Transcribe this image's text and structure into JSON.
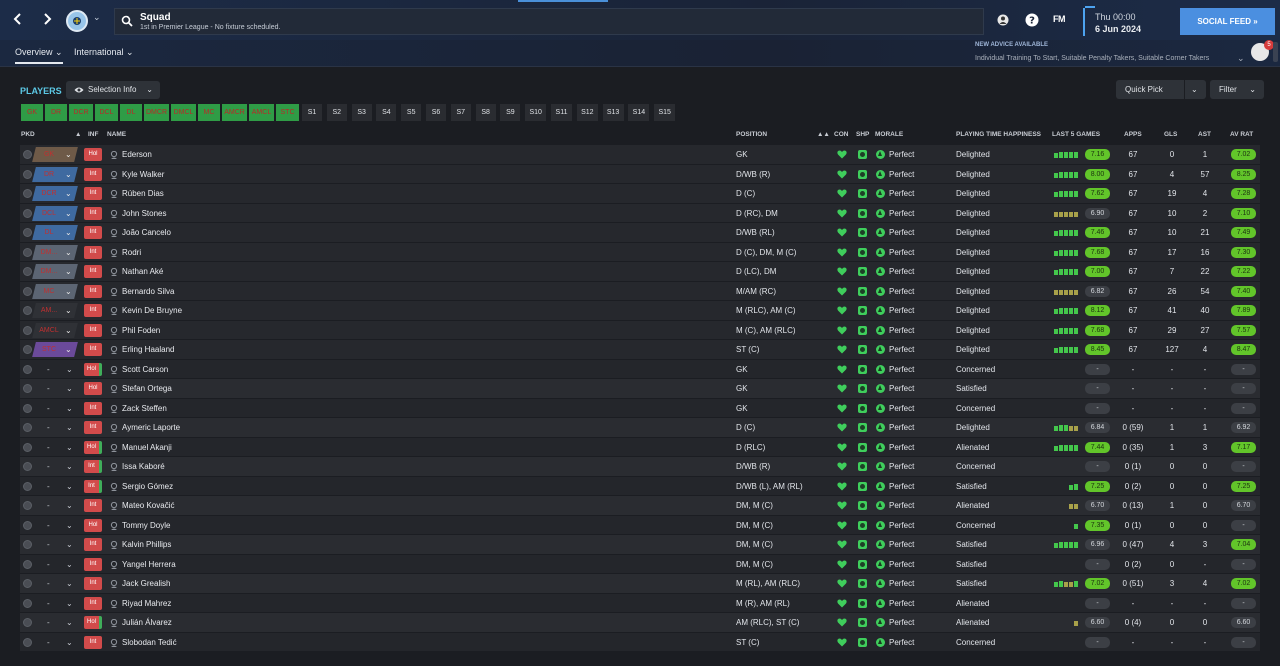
{
  "topbar": {
    "title": "Squad",
    "subtitle": "1st in Premier League - No fixture scheduled.",
    "fm_logo": "FM",
    "date_day": "Thu 00:00",
    "date_date": "6 Jun 2024",
    "social_feed": "SOCIAL FEED  »",
    "back_icon": "chevron-left-icon",
    "forward_icon": "chevron-right-icon"
  },
  "subbar": {
    "tabs": [
      {
        "label": "Overview ⌄"
      },
      {
        "label": "International ⌄"
      }
    ],
    "advice_title": "NEW ADVICE AVAILABLE",
    "advice_text": "Individual Training To Start, Suitable Penalty Takers, Suitable Corner Takers",
    "advice_count": "5"
  },
  "players": {
    "title": "PLAYERS",
    "selection_info": "Selection Info",
    "quick_pick": "Quick Pick",
    "filter": "Filter"
  },
  "position_buttons": [
    "GK",
    "DR",
    "DCR",
    "DCL",
    "DL",
    "DMCR",
    "DMCL",
    "MC",
    "AMCR",
    "AMCL",
    "STC",
    "S1",
    "S2",
    "S3",
    "S4",
    "S5",
    "S6",
    "S7",
    "S8",
    "S9",
    "S10",
    "S11",
    "S12",
    "S13",
    "S14",
    "S15"
  ],
  "columns": {
    "pkd": "PKD",
    "inf": "INF",
    "name": "NAME",
    "position": "POSITION",
    "con": "CON",
    "shp": "SHP",
    "morale": "MORALE",
    "pth": "PLAYING TIME HAPPINESS",
    "last5": "LAST 5 GAMES",
    "apps": "APPS",
    "gls": "GLS",
    "ast": "AST",
    "avrat": "AV RAT"
  },
  "rows": [
    {
      "pkd": "GK",
      "pkd_color": "#6e5a48",
      "inf": "Hol",
      "name": "Ederson",
      "position": "GK",
      "morale": "Perfect",
      "pth": "Delighted",
      "form": [
        3,
        4,
        4,
        4,
        4
      ],
      "last": "7.16",
      "apps": "67",
      "gls": "0",
      "ast": "1",
      "avrat": "7.02",
      "green_edge": false
    },
    {
      "pkd": "DR",
      "pkd_color": "#3f6aa0",
      "inf": "Int",
      "name": "Kyle Walker",
      "position": "D/WB (R)",
      "morale": "Perfect",
      "pth": "Delighted",
      "form": [
        3,
        4,
        4,
        4,
        4
      ],
      "last": "8.00",
      "apps": "67",
      "gls": "4",
      "ast": "57",
      "avrat": "8.25",
      "green_edge": false
    },
    {
      "pkd": "DCR",
      "pkd_color": "#3f6aa0",
      "inf": "Int",
      "name": "Rúben Dias",
      "position": "D (C)",
      "morale": "Perfect",
      "pth": "Delighted",
      "form": [
        3,
        4,
        4,
        4,
        4
      ],
      "last": "7.62",
      "apps": "67",
      "gls": "19",
      "ast": "4",
      "avrat": "7.28",
      "green_edge": false
    },
    {
      "pkd": "DCL",
      "pkd_color": "#3f6aa0",
      "inf": "Int",
      "name": "John Stones",
      "position": "D (RC), DM",
      "morale": "Perfect",
      "pth": "Delighted",
      "form": [
        1,
        1,
        1,
        1,
        1
      ],
      "last": "6.90",
      "apps": "67",
      "gls": "10",
      "ast": "2",
      "avrat": "7.10",
      "green_edge": false,
      "last_dark": true
    },
    {
      "pkd": "DL",
      "pkd_color": "#3f6aa0",
      "inf": "Int",
      "name": "João Cancelo",
      "position": "D/WB (RL)",
      "morale": "Perfect",
      "pth": "Delighted",
      "form": [
        3,
        4,
        4,
        4,
        4
      ],
      "last": "7.46",
      "apps": "67",
      "gls": "10",
      "ast": "21",
      "avrat": "7.49",
      "green_edge": false
    },
    {
      "pkd": "DM...",
      "pkd_color": "#5c6573",
      "inf": "Int",
      "name": "Rodri",
      "position": "D (C), DM, M (C)",
      "morale": "Perfect",
      "pth": "Delighted",
      "form": [
        3,
        4,
        4,
        4,
        4
      ],
      "last": "7.68",
      "apps": "67",
      "gls": "17",
      "ast": "16",
      "avrat": "7.30",
      "green_edge": false
    },
    {
      "pkd": "DM...",
      "pkd_color": "#5c6573",
      "inf": "Int",
      "name": "Nathan Aké",
      "position": "D (LC), DM",
      "morale": "Perfect",
      "pth": "Delighted",
      "form": [
        3,
        4,
        4,
        4,
        4
      ],
      "last": "7.00",
      "apps": "67",
      "gls": "7",
      "ast": "22",
      "avrat": "7.22",
      "green_edge": false
    },
    {
      "pkd": "MC",
      "pkd_color": "#5c6573",
      "inf": "Int",
      "name": "Bernardo Silva",
      "position": "M/AM (RC)",
      "morale": "Perfect",
      "pth": "Delighted",
      "form": [
        1,
        1,
        1,
        1,
        1
      ],
      "last": "6.82",
      "apps": "67",
      "gls": "26",
      "ast": "54",
      "avrat": "7.40",
      "green_edge": false,
      "last_dark": true
    },
    {
      "pkd": "AM...",
      "pkd_color": "#2f3136",
      "inf": "Int",
      "name": "Kevin De Bruyne",
      "position": "M (RLC), AM (C)",
      "morale": "Perfect",
      "pth": "Delighted",
      "form": [
        3,
        4,
        4,
        4,
        4
      ],
      "last": "8.12",
      "apps": "67",
      "gls": "41",
      "ast": "40",
      "avrat": "7.89",
      "green_edge": false
    },
    {
      "pkd": "AMCL",
      "pkd_color": "#2f3136",
      "inf": "Int",
      "name": "Phil Foden",
      "position": "M (C), AM (RLC)",
      "morale": "Perfect",
      "pth": "Delighted",
      "form": [
        3,
        4,
        4,
        4,
        4
      ],
      "last": "7.68",
      "apps": "67",
      "gls": "29",
      "ast": "27",
      "avrat": "7.57",
      "green_edge": false
    },
    {
      "pkd": "STC",
      "pkd_color": "#6b4a9a",
      "inf": "Int",
      "name": "Erling Haaland",
      "position": "ST (C)",
      "morale": "Perfect",
      "pth": "Delighted",
      "form": [
        3,
        4,
        4,
        4,
        4
      ],
      "last": "8.45",
      "apps": "67",
      "gls": "127",
      "ast": "4",
      "avrat": "8.47",
      "green_edge": false
    },
    {
      "pkd": "",
      "inf": "Hol",
      "name": "Scott Carson",
      "position": "GK",
      "morale": "Perfect",
      "pth": "Concerned",
      "form": [],
      "last": "-",
      "apps": "-",
      "gls": "-",
      "ast": "-",
      "avrat": "-",
      "green_edge": true
    },
    {
      "pkd": "",
      "inf": "Hol",
      "name": "Stefan Ortega",
      "position": "GK",
      "morale": "Perfect",
      "pth": "Satisfied",
      "form": [],
      "last": "-",
      "apps": "-",
      "gls": "-",
      "ast": "-",
      "avrat": "-",
      "green_edge": false
    },
    {
      "pkd": "",
      "inf": "Int",
      "name": "Zack Steffen",
      "position": "GK",
      "morale": "Perfect",
      "pth": "Concerned",
      "form": [],
      "last": "-",
      "apps": "-",
      "gls": "-",
      "ast": "-",
      "avrat": "-",
      "green_edge": false
    },
    {
      "pkd": "",
      "inf": "Int",
      "name": "Aymeric Laporte",
      "position": "D (C)",
      "morale": "Perfect",
      "pth": "Delighted",
      "form": [
        3,
        4,
        4,
        1,
        1
      ],
      "last": "6.84",
      "apps": "0 (59)",
      "gls": "1",
      "ast": "1",
      "avrat": "6.92",
      "green_edge": false,
      "last_dark": true,
      "av_dark": true
    },
    {
      "pkd": "",
      "inf": "Hol",
      "name": "Manuel Akanji",
      "position": "D (RLC)",
      "morale": "Perfect",
      "pth": "Alienated",
      "form": [
        3,
        4,
        4,
        4,
        4
      ],
      "last": "7.44",
      "apps": "0 (35)",
      "gls": "1",
      "ast": "3",
      "avrat": "7.17",
      "green_edge": true
    },
    {
      "pkd": "",
      "inf": "Int",
      "name": "Issa Kaboré",
      "position": "D/WB (R)",
      "morale": "Perfect",
      "pth": "Concerned",
      "form": [],
      "last": "-",
      "apps": "0 (1)",
      "gls": "0",
      "ast": "0",
      "avrat": "-",
      "green_edge": true
    },
    {
      "pkd": "",
      "inf": "Int",
      "name": "Sergio Gómez",
      "position": "D/WB (L), AM (RL)",
      "morale": "Perfect",
      "pth": "Satisfied",
      "form": [
        3,
        4
      ],
      "last": "7.25",
      "apps": "0 (2)",
      "gls": "0",
      "ast": "0",
      "avrat": "7.25",
      "green_edge": true
    },
    {
      "pkd": "",
      "inf": "Int",
      "name": "Mateo Kovačić",
      "position": "DM, M (C)",
      "morale": "Perfect",
      "pth": "Alienated",
      "form": [
        1,
        1
      ],
      "last": "6.70",
      "apps": "0 (13)",
      "gls": "1",
      "ast": "0",
      "avrat": "6.70",
      "green_edge": false,
      "last_dark": true,
      "av_dark": true
    },
    {
      "pkd": "",
      "inf": "Hol",
      "name": "Tommy Doyle",
      "position": "DM, M (C)",
      "morale": "Perfect",
      "pth": "Concerned",
      "form": [
        3
      ],
      "last": "7.35",
      "apps": "0 (1)",
      "gls": "0",
      "ast": "0",
      "avrat": "-",
      "green_edge": false
    },
    {
      "pkd": "",
      "inf": "Int",
      "name": "Kalvin Phillips",
      "position": "DM, M (C)",
      "morale": "Perfect",
      "pth": "Satisfied",
      "form": [
        3,
        4,
        4,
        4,
        4
      ],
      "last": "6.96",
      "apps": "0 (47)",
      "gls": "4",
      "ast": "3",
      "avrat": "7.04",
      "green_edge": false,
      "last_dark": true
    },
    {
      "pkd": "",
      "inf": "Int",
      "name": "Yangel Herrera",
      "position": "DM, M (C)",
      "morale": "Perfect",
      "pth": "Satisfied",
      "form": [],
      "last": "-",
      "apps": "0 (2)",
      "gls": "0",
      "ast": "-",
      "avrat": "-",
      "green_edge": false
    },
    {
      "pkd": "",
      "inf": "Int",
      "name": "Jack Grealish",
      "position": "M (RL), AM (RLC)",
      "morale": "Perfect",
      "pth": "Satisfied",
      "form": [
        3,
        4,
        1,
        1,
        4
      ],
      "last": "7.02",
      "apps": "0 (51)",
      "gls": "3",
      "ast": "4",
      "avrat": "7.02",
      "green_edge": false
    },
    {
      "pkd": "",
      "inf": "Int",
      "name": "Riyad Mahrez",
      "position": "M (R), AM (RL)",
      "morale": "Perfect",
      "pth": "Alienated",
      "form": [],
      "last": "-",
      "apps": "-",
      "gls": "-",
      "ast": "-",
      "avrat": "-",
      "green_edge": false
    },
    {
      "pkd": "",
      "inf": "Hol",
      "name": "Julián Álvarez",
      "position": "AM (RLC), ST (C)",
      "morale": "Perfect",
      "pth": "Alienated",
      "form": [
        1
      ],
      "last": "6.60",
      "apps": "0 (4)",
      "gls": "0",
      "ast": "0",
      "avrat": "6.60",
      "green_edge": true,
      "last_dark": true,
      "av_dark": true
    },
    {
      "pkd": "",
      "inf": "Int",
      "name": "Slobodan Tedić",
      "position": "ST (C)",
      "morale": "Perfect",
      "pth": "Concerned",
      "form": [],
      "last": "-",
      "apps": "-",
      "gls": "-",
      "ast": "-",
      "avrat": "-",
      "green_edge": false
    }
  ],
  "colors": {
    "accent": "#4b8fe0",
    "good": "#62c52a",
    "bad": "#d24b4b",
    "header_cyan": "#5cc9e6"
  }
}
